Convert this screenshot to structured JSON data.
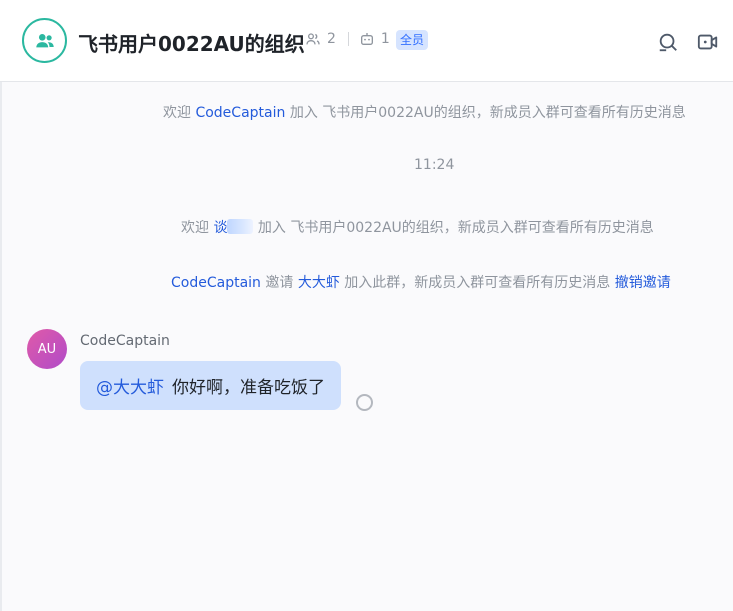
{
  "header": {
    "title": "飞书用户0022AU的组织",
    "member_count": "2",
    "bot_count": "1",
    "badge": "全员"
  },
  "system_messages": [
    {
      "prefix": "欢迎",
      "name": "CodeCaptain",
      "text": "加入 飞书用户0022AU的组织，新成员入群可查看所有历史消息"
    },
    {
      "prefix": "欢迎",
      "name": "谈",
      "text": "加入 飞书用户0022AU的组织，新成员入群可查看所有历史消息"
    },
    {
      "name": "CodeCaptain",
      "mid": "邀请",
      "name2": "大大虾",
      "text": "加入此群，新成员入群可查看所有历史消息",
      "action": "撤销邀请"
    }
  ],
  "time_divider": "11:24",
  "message": {
    "avatar_text": "AU",
    "sender": "CodeCaptain",
    "mention": "@大大虾",
    "text": "你好啊，准备吃饭了"
  },
  "colors": {
    "accent": "#245bdb",
    "group_avatar": "#2bb8a0",
    "bubble": "#cfe0fd"
  }
}
